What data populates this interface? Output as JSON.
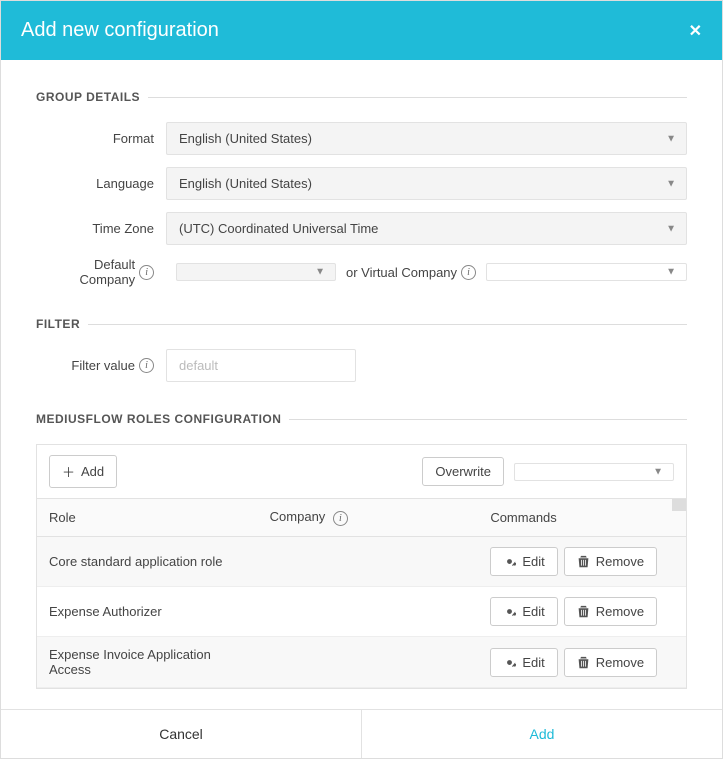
{
  "header": {
    "title": "Add new configuration"
  },
  "sections": {
    "group_details": "GROUP DETAILS",
    "filter": "FILTER",
    "roles": "MEDIUSFLOW ROLES CONFIGURATION"
  },
  "group": {
    "format_label": "Format",
    "format_value": "English (United States)",
    "language_label": "Language",
    "language_value": "English (United States)",
    "timezone_label": "Time Zone",
    "timezone_value": "(UTC) Coordinated Universal Time",
    "default_company_label": "Default Company",
    "default_company_value": "",
    "or_virtual_label": "or Virtual Company",
    "virtual_company_value": ""
  },
  "filter": {
    "label": "Filter value",
    "placeholder": "default",
    "value": ""
  },
  "roles": {
    "add_label": "Add",
    "overwrite_label": "Overwrite",
    "overwrite_value": "",
    "columns": {
      "role": "Role",
      "company": "Company",
      "commands": "Commands"
    },
    "rows": [
      {
        "role": "Core standard application role",
        "company": ""
      },
      {
        "role": "Expense Authorizer",
        "company": ""
      },
      {
        "role": "Expense Invoice Application Access",
        "company": ""
      }
    ],
    "edit_label": "Edit",
    "remove_label": "Remove"
  },
  "footer": {
    "cancel": "Cancel",
    "add": "Add"
  }
}
